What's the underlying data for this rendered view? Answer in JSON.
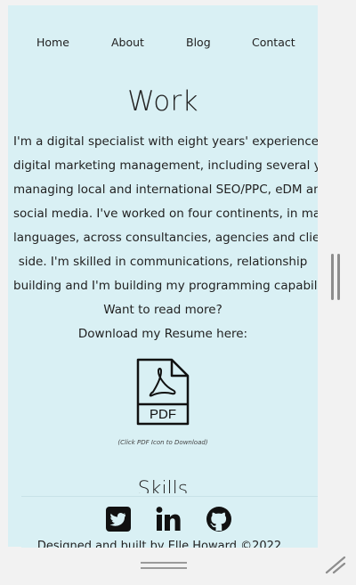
{
  "nav": {
    "home": "Home",
    "about": "About",
    "blog": "Blog",
    "contact": "Contact"
  },
  "work": {
    "title": "Work",
    "lines": [
      "I'm a digital specialist with eight years' experience in",
      "digital marketing management, including several years",
      "managing local and international SEO/PPC, eDM and",
      "social media. I've worked on four continents, in many",
      "languages, across consultancies, agencies and client-",
      "side. I'm skilled in communications, relationship",
      "building and I'm building my programming capabilities.",
      "Want to read more?",
      "Download my Resume here:"
    ]
  },
  "resume": {
    "icon_label": "PDF",
    "caption": "(Click PDF Icon to Download)"
  },
  "skills": {
    "title": "Skills"
  },
  "footer": {
    "credit": "Designed and built by Elle Howard ©2022"
  },
  "colors": {
    "panel": "#d9f0f4",
    "frame": "#f2f2f2",
    "text": "#222222"
  },
  "icons": [
    "twitter-icon",
    "linkedin-icon",
    "github-icon",
    "pdf-icon"
  ]
}
